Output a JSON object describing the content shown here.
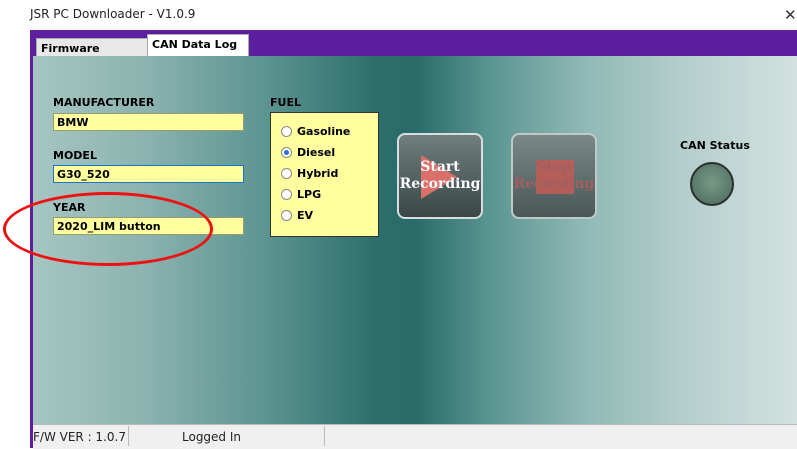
{
  "window": {
    "title": "JSR PC Downloader - V1.0.9",
    "close_glyph": "✕"
  },
  "tabs": [
    {
      "label": "Firmware _Sound"
    },
    {
      "label": "CAN Data Log"
    }
  ],
  "form": {
    "manufacturer": {
      "label": "MANUFACTURER",
      "value": "BMW"
    },
    "model": {
      "label": "MODEL",
      "value": "G30_520"
    },
    "year": {
      "label": "YEAR",
      "value": "2020_LIM button"
    }
  },
  "fuel": {
    "label": "FUEL",
    "options": [
      "Gasoline",
      "Diesel",
      "Hybrid",
      "LPG",
      "EV"
    ],
    "selected": "Diesel"
  },
  "buttons": {
    "start": {
      "line1": "Start",
      "line2": "Recording"
    },
    "stop": {
      "line1": "Stop",
      "line2": "Recording"
    }
  },
  "can_status": {
    "label": "CAN Status"
  },
  "statusbar": {
    "fw_ver": "F/W VER : 1.0.7",
    "login": "Logged In"
  },
  "colors": {
    "accent_frame": "#5b1fa0",
    "field_bg": "#ffffa0",
    "annotation_red": "#ee1111"
  }
}
